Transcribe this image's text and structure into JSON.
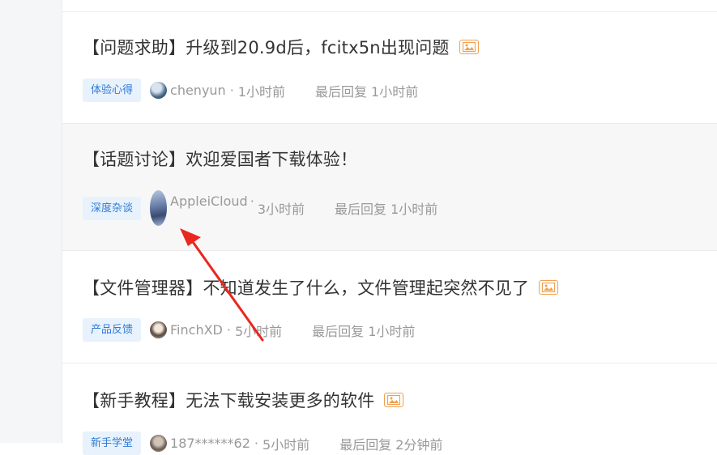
{
  "posts": [
    {
      "title": "【问题求助】升级到20.9d后，fcitx5n出现问题",
      "has_image": true,
      "tag": "体验心得",
      "author": "chenyun",
      "time": "1小时前",
      "last_reply": "最后回复 1小时前",
      "highlighted": false
    },
    {
      "title": "【话题讨论】欢迎爱国者下载体验！",
      "has_image": false,
      "tag": "深度杂谈",
      "author": "AppleiCloud",
      "time": "3小时前",
      "last_reply": "最后回复 1小时前",
      "highlighted": true
    },
    {
      "title": "【文件管理器】不知道发生了什么，文件管理起突然不见了",
      "has_image": true,
      "tag": "产品反馈",
      "author": "FinchXD",
      "time": "5小时前",
      "last_reply": "最后回复 1小时前",
      "highlighted": false
    },
    {
      "title": "【新手教程】无法下载安装更多的软件",
      "has_image": true,
      "tag": "新手学堂",
      "author": "187******62",
      "time": "5小时前",
      "last_reply": "最后回复 2分钟前",
      "highlighted": false
    }
  ],
  "colors": {
    "tag_bg": "#e8f2fd",
    "tag_text": "#2f7bd5",
    "image_badge": "#f0a050",
    "annotation_arrow": "#e8281f",
    "highlight_bg": "#f7f7f7"
  },
  "icons": {
    "image_badge": "image-icon",
    "annotation": "red-arrow-annotation"
  }
}
